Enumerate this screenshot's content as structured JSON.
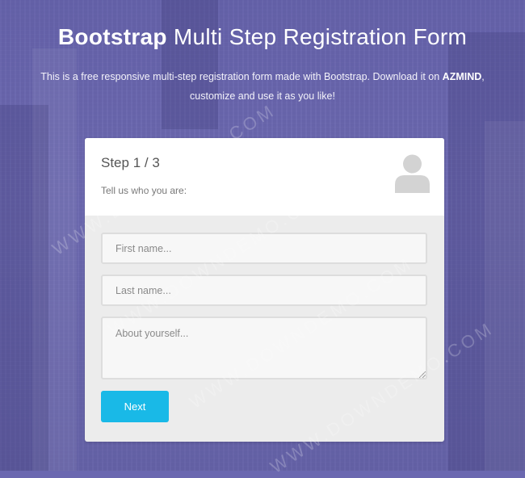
{
  "header": {
    "title_bold": "Bootstrap",
    "title_rest": " Multi Step Registration Form",
    "description_prefix": "This is a free responsive multi-step registration form made with Bootstrap. Download it on ",
    "description_brand": "AZMIND",
    "description_suffix": ", customize and use it as you like!"
  },
  "form": {
    "step_label": "Step 1 / 3",
    "subtitle": "Tell us who you are:",
    "icon": "user-icon",
    "first_name_placeholder": "First name...",
    "last_name_placeholder": "Last name...",
    "about_placeholder": "About yourself...",
    "next_label": "Next"
  },
  "watermark": "WWW.DOWNDEMO.COM",
  "colors": {
    "background": "#6a67ae",
    "button": "#19b9e7",
    "card": "#ececec"
  }
}
